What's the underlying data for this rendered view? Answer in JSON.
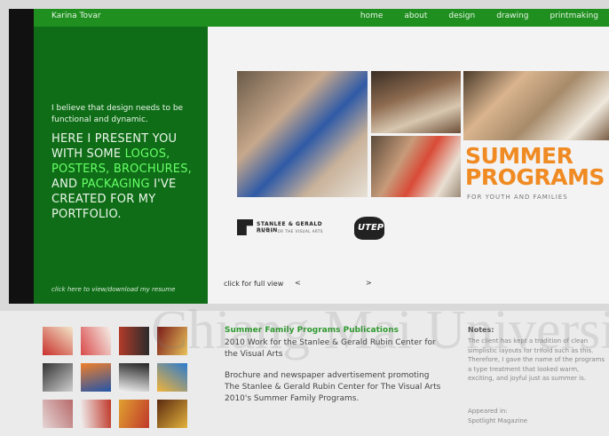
{
  "header": {
    "site_name": "Karina Tovar",
    "nav": [
      {
        "label": "home"
      },
      {
        "label": "about"
      },
      {
        "label": "design"
      },
      {
        "label": "drawing"
      },
      {
        "label": "printmaking"
      }
    ]
  },
  "intro": {
    "small": "I believe that design needs to be functional and dynamic.",
    "big_parts": [
      "HERE I PRESENT YOU WITH SOME ",
      "LOGOS, POSTERS, BROCHURES, ",
      "AND ",
      "PACKAGING",
      " I'VE CREATED FOR MY PORTFOLIO."
    ],
    "resume_link": "click here to view/download my resume"
  },
  "gallery": {
    "summer_title_1": "SUMMER",
    "summer_title_2": "PROGRAMS",
    "summer_subtitle": "FOR YOUTH AND FAMILIES",
    "rubin_line1": "STANLEE & GERALD RUBIN",
    "rubin_line2": "CENTER FOR THE VISUAL ARTS",
    "utep_logo": "UTEP",
    "full_view": "click for full view",
    "prev": "<",
    "next": ">"
  },
  "publication": {
    "title": "Summer Family Programs Publications",
    "desc1": "2010 Work for the Stanlee & Gerald Rubin Center for the Visual Arts",
    "desc2": "Brochure and newspaper advertisement promoting The Stanlee & Gerald Rubin Center for The Visual Arts 2010's Summer Family Programs."
  },
  "notes": {
    "heading": "Notes:",
    "body": "The client has kept a tradition of clean simplistic layouts for trifold such as this. Therefore, I gave the name of the programs a type treatment that looked warm, exciting, and joyful just as summer is.",
    "appeared": "Appeared in:",
    "magazine": "Spotlight Magazine"
  },
  "thumbnails": [
    {
      "colors": [
        "#c9302c",
        "#f2e6c9"
      ]
    },
    {
      "colors": [
        "#d94a4a",
        "#f5f1ea"
      ]
    },
    {
      "colors": [
        "#b23b2a",
        "#2b2b2b"
      ]
    },
    {
      "colors": [
        "#7a1a1a",
        "#e8c25a"
      ]
    },
    {
      "colors": [
        "#333333",
        "#cfcfcf"
      ]
    },
    {
      "colors": [
        "#f07f2a",
        "#2255aa"
      ]
    },
    {
      "colors": [
        "#222222",
        "#f2f2f2"
      ]
    },
    {
      "colors": [
        "#2a7bd0",
        "#f0b33a"
      ]
    },
    {
      "colors": [
        "#b86b6b",
        "#e5d5d5"
      ]
    },
    {
      "colors": [
        "#c0392b",
        "#f0f0f0"
      ]
    },
    {
      "colors": [
        "#c0392b",
        "#e0a030"
      ]
    },
    {
      "colors": [
        "#e3b23c",
        "#5a2a10"
      ]
    }
  ],
  "watermark_text": "Chiang Mai University"
}
